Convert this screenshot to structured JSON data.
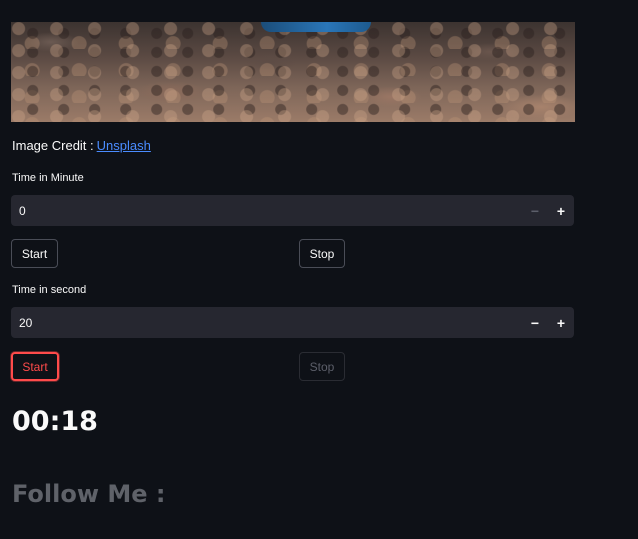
{
  "credit": {
    "label": "Image Credit :",
    "link_text": "Unsplash"
  },
  "minute": {
    "label": "Time in Minute",
    "value": "0",
    "decrement": "−",
    "increment": "+",
    "start_label": "Start",
    "stop_label": "Stop"
  },
  "second": {
    "label": "Time in second",
    "value": "20",
    "decrement": "−",
    "increment": "+",
    "start_label": "Start",
    "stop_label": "Stop"
  },
  "timer": {
    "display": "00:18"
  },
  "follow": {
    "heading": "Follow Me :"
  },
  "colors": {
    "background": "#0e1117",
    "input": "#262730",
    "accent": "#ff4b4b",
    "link": "#4a8cff"
  }
}
